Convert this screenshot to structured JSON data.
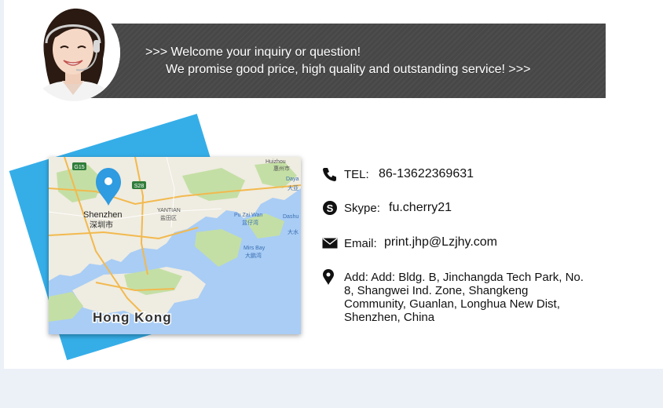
{
  "banner": {
    "line1": ">>> Welcome your inquiry or question!",
    "line2": "We promise good price, high quality and outstanding service!  >>>"
  },
  "map": {
    "labels": {
      "shenzhen": "Shenzhen",
      "shenzhen_cn": "深圳市",
      "hongkong": "Hong Kong",
      "huizhou": "Huizhou",
      "huizhou_cn": "惠州市",
      "dayawan": "Daya",
      "dayawan_cn": "大亚",
      "dashu": "Dashu",
      "dashu_cn": "大水",
      "pu_zai_wan": "Pu Zai Wan",
      "pu_zai_wan_cn": "盆仔湾",
      "mirs_bay": "Mirs Bay",
      "mirs_bay_cn": "大鹏湾",
      "yantian": "YANTIAN",
      "yantian_cn": "盐田区",
      "g15": "G15",
      "s28": "S28"
    }
  },
  "contact": {
    "tel_label": "TEL:",
    "tel_value": "86-13622369631",
    "skype_label": "Skype:",
    "skype_value": "fu.cherry21",
    "email_label": "Email:",
    "email_value": "print.jhp@Lzjhy.com",
    "address": "Add: Add: Bldg. B, Jinchangda Tech Park, No. 8, Shangwei Ind. Zone, Shangkeng Community, Guanlan, Longhua New Dist, Shenzhen, China"
  },
  "colors": {
    "banner_bg": "#474747",
    "map_accent": "#35aee8",
    "page_bg": "#ecf1f8"
  },
  "icons": {
    "tel": "phone-icon",
    "skype": "skype-icon",
    "email": "envelope-icon",
    "address": "location-pin-icon",
    "map_marker": "map-pin-icon"
  }
}
